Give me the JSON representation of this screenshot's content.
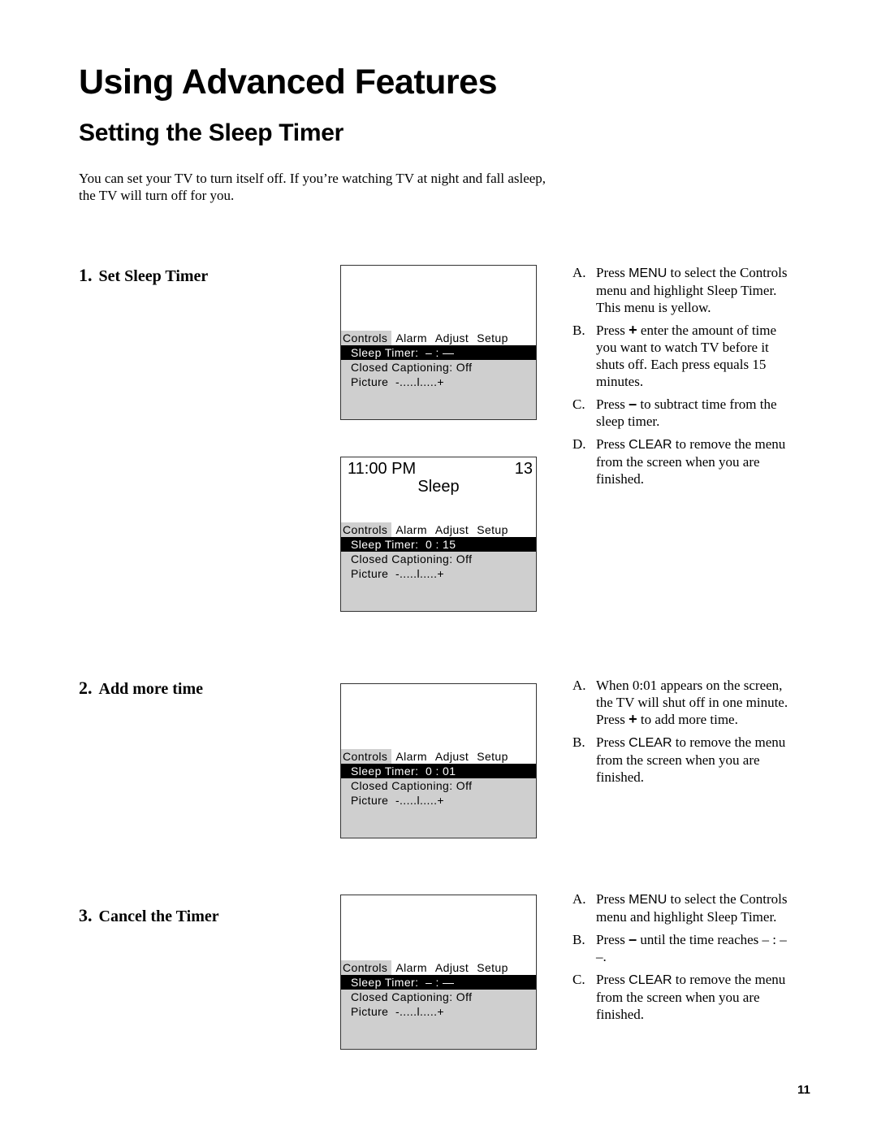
{
  "page": {
    "title": "Using Advanced Features",
    "subtitle": "Setting the Sleep Timer",
    "intro": "You can set your TV to turn itself off.  If you’re watching TV at night and fall asleep, the TV will turn off for you.",
    "page_number": "11"
  },
  "menu_tabs": [
    "Controls",
    "Alarm",
    "Adjust",
    "Setup"
  ],
  "screens": [
    {
      "clock": "",
      "channel": "",
      "status": "",
      "sleep_timer": "Sleep Timer:  – : —",
      "closed_captioning": "Closed Captioning: Off",
      "picture": "Picture  -.....l.....+"
    },
    {
      "clock": "11:00 PM",
      "channel": "13",
      "status": "Sleep",
      "sleep_timer": "Sleep Timer:  0 : 15",
      "closed_captioning": "Closed Captioning: Off",
      "picture": "Picture  -.....l.....+"
    },
    {
      "clock": "",
      "channel": "",
      "status": "",
      "sleep_timer": "Sleep Timer:  0 : 01",
      "closed_captioning": "Closed Captioning: Off",
      "picture": "Picture  -.....l.....+"
    },
    {
      "clock": "",
      "channel": "",
      "status": "",
      "sleep_timer": "Sleep Timer:  – : —",
      "closed_captioning": "Closed Captioning: Off",
      "picture": "Picture  -.....l.....+"
    }
  ],
  "steps": [
    {
      "number": "1.",
      "title": "Set Sleep Timer",
      "instructions": [
        {
          "label": "A.",
          "pre": "Press ",
          "key": "MENU",
          "post": " to select the Controls menu and highlight Sleep Timer. This menu is yellow."
        },
        {
          "label": "B.",
          "pre": "Press ",
          "key": "+",
          "post": " enter the amount of time you want to watch TV before it shuts off. Each press equals 15 minutes."
        },
        {
          "label": "C.",
          "pre": "Press ",
          "key": "–",
          "post": " to  subtract time from the sleep timer."
        },
        {
          "label": "D.",
          "pre": "Press ",
          "key": "CLEAR",
          "post": " to remove the menu from the screen when you are finished."
        }
      ]
    },
    {
      "number": "2.",
      "title": "Add more time",
      "instructions": [
        {
          "label": "A.",
          "pre": "When 0:01 appears on the screen, the TV will shut off in one minute.  Press ",
          "key": "+",
          "post": " to add more time."
        },
        {
          "label": "B.",
          "pre": "Press ",
          "key": "CLEAR",
          "post": " to remove the menu from the screen when you are finished."
        }
      ]
    },
    {
      "number": "3.",
      "title": "Cancel the Timer",
      "instructions": [
        {
          "label": "A.",
          "pre": "Press ",
          "key": "MENU",
          "post": " to select the Controls menu and highlight Sleep Timer."
        },
        {
          "label": "B.",
          "pre": "Press ",
          "key": "–",
          "post": " until the time reaches – : – –."
        },
        {
          "label": "C.",
          "pre": "Press ",
          "key": "CLEAR",
          "post": " to remove the menu from the screen when you are finished."
        }
      ]
    }
  ]
}
